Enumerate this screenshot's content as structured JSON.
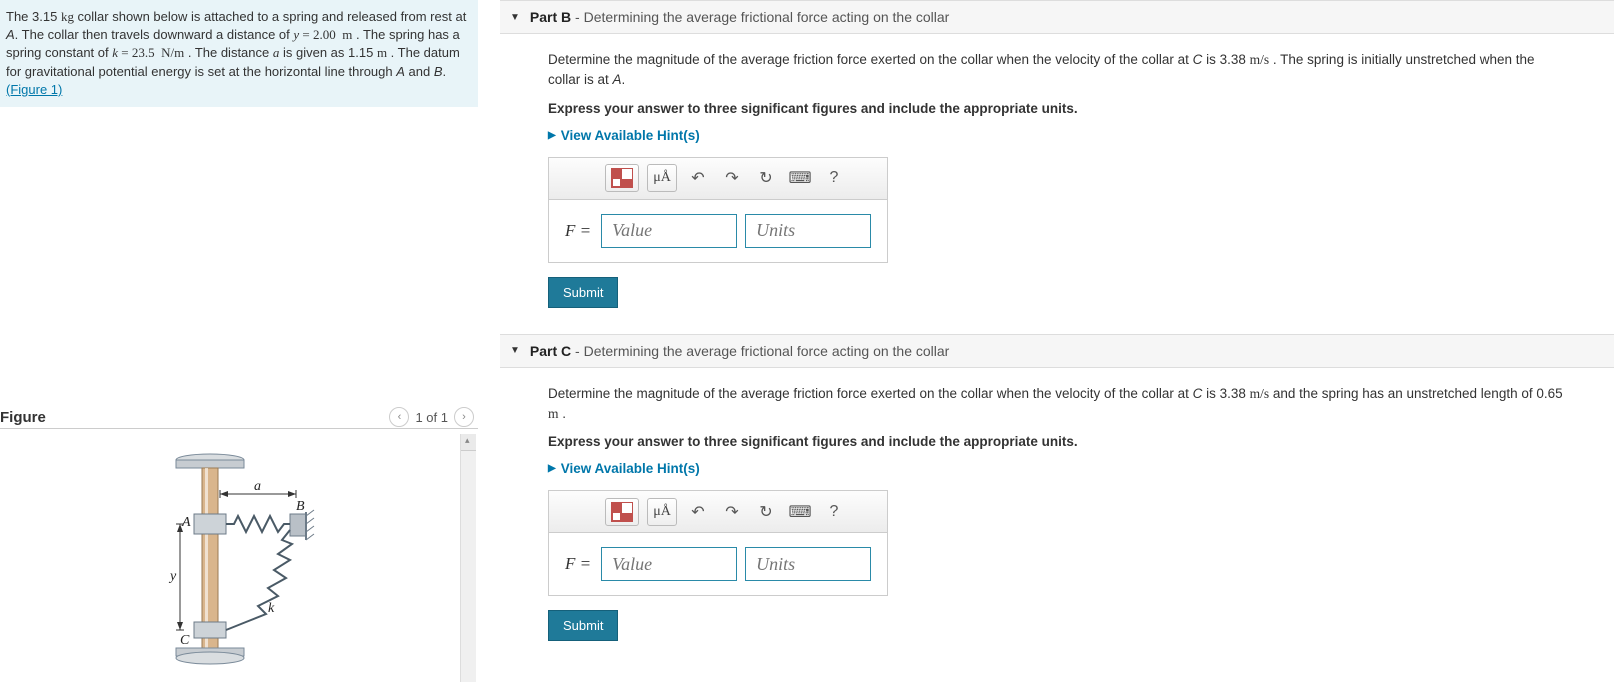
{
  "problem": {
    "text_html": "The 3.15 <span class='serif'>kg</span> collar shown below is attached to a spring and released from rest at <i>A</i>. The collar then travels downward a distance of <span class='serif'><i>y</i> = 2.00&nbsp; m</span> . The spring has a spring constant of <span class='serif'><i>k</i> = 23.5&nbsp; N/m</span> . The distance <span class='serif'><i>a</i></span> is given as 1.15 <span class='serif'>m</span> . The datum for gravitational potential energy is set at the horizontal line through <i>A</i> and <i>B</i>.",
    "figure_link": "(Figure 1)"
  },
  "figure": {
    "title": "Figure",
    "counter": "1 of 1",
    "labels": {
      "a": "a",
      "A": "A",
      "B": "B",
      "y": "y",
      "k": "k",
      "C": "C"
    }
  },
  "parts": [
    {
      "label": "Part B",
      "subtitle": "Determining the average frictional force acting on the collar",
      "question_html": "Determine the magnitude of the average friction force exerted on the collar when the velocity of the collar at <i>C</i> is 3.38 <span class='serif'>m/s</span> . The spring is initially unstretched when the collar is at <i>A</i>.",
      "instruction": "Express your answer to three significant figures and include the appropriate units.",
      "hints": "View Available Hint(s)",
      "var": "F =",
      "value_ph": "Value",
      "units_ph": "Units",
      "submit": "Submit",
      "toolbar": {
        "tmpl": "",
        "greek": "μÅ",
        "undo": "↶",
        "redo": "↷",
        "reset": "↻",
        "kbd": "⌨",
        "help": "?"
      }
    },
    {
      "label": "Part C",
      "subtitle": "Determining the average frictional force acting on the collar",
      "question_html": "Determine the magnitude of the average friction force exerted on the collar when the velocity of the collar at <i>C</i> is 3.38 <span class='serif'>m/s</span> and the  spring has an unstretched length of 0.65 <span class='serif'>m</span> .",
      "instruction": "Express your answer to three significant figures and include the appropriate units.",
      "hints": "View Available Hint(s)",
      "var": "F =",
      "value_ph": "Value",
      "units_ph": "Units",
      "submit": "Submit",
      "toolbar": {
        "tmpl": "",
        "greek": "μÅ",
        "undo": "↶",
        "redo": "↷",
        "reset": "↻",
        "kbd": "⌨",
        "help": "?"
      }
    }
  ]
}
